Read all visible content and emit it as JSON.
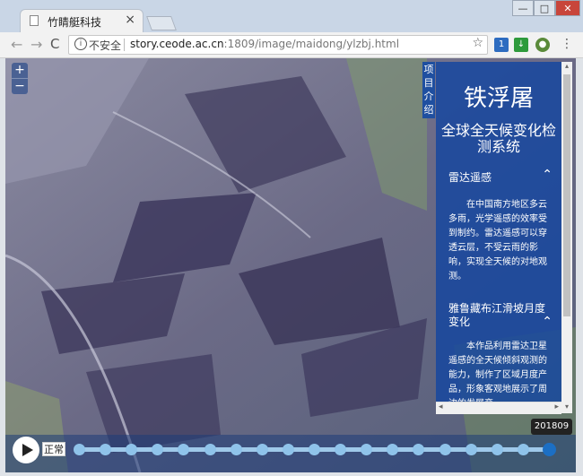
{
  "browser": {
    "tab_title": "竹睛艇科技",
    "tab_close": "×",
    "win_min": "—",
    "win_max": "□",
    "win_close": "✕",
    "nav_back": "←",
    "nav_forward": "→",
    "nav_reload": "C",
    "security_label": "不安全",
    "url_host": "story.ceode.ac.cn",
    "url_path": ":1809/image/maidong/ylzbj.html",
    "bookmark_star": "☆",
    "ext_badge": "1",
    "menu_dots": "⋮"
  },
  "map": {
    "zoom_in": "+",
    "zoom_out": "−"
  },
  "panel": {
    "side_tab_label": "项目介绍",
    "title": "铁浮屠",
    "subtitle": "全球全天候变化检测系统",
    "sections": [
      {
        "heading": "雷达遥感",
        "chevron": "⌃",
        "body": "在中国南方地区多云多雨，光学遥感的效率受到制约。雷达遥感可以穿透云层，不受云雨的影响，实现全天候的对地观测。"
      },
      {
        "heading": "雅鲁藏布江滑坡月度变化",
        "chevron": "⌃",
        "body": "本作品利用雷达卫星遥感的全天候倾斜观测的能力，制作了区域月度产品，形象客观地展示了周边的发展变"
      }
    ],
    "scroll_left": "◂",
    "scroll_right": "▸",
    "scroll_up": "▴",
    "scroll_down": "▾"
  },
  "timeline": {
    "speed_label": "正常",
    "current": "201809",
    "steps": 19,
    "active_index": 18
  }
}
